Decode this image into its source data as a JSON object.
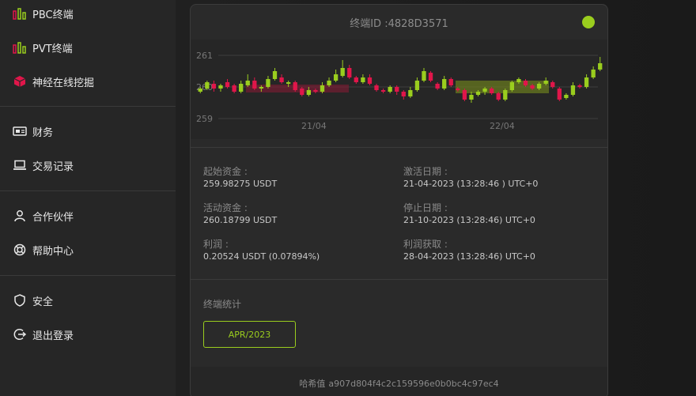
{
  "sidebar": {
    "items": [
      {
        "label": "PBC终端",
        "icon": "bar-chart-icon"
      },
      {
        "label": "PVT终端",
        "icon": "bar-chart-icon"
      },
      {
        "label": "神经在线挖掘",
        "icon": "cube-icon"
      },
      {
        "label": "财务",
        "icon": "wallet-icon"
      },
      {
        "label": "交易记录",
        "icon": "laptop-icon"
      },
      {
        "label": "合作伙伴",
        "icon": "user-icon"
      },
      {
        "label": "帮助中心",
        "icon": "lifebuoy-icon"
      },
      {
        "label": "安全",
        "icon": "shield-icon"
      },
      {
        "label": "退出登录",
        "icon": "logout-icon"
      }
    ]
  },
  "terminal": {
    "title": "终端ID :4828D3571",
    "status_color": "#9acd1e"
  },
  "chart_data": {
    "type": "candlestick",
    "y_ticks": [
      "261",
      "260",
      "259"
    ],
    "x_ticks": [
      "21/04",
      "22/04"
    ],
    "ylim": [
      258.8,
      261.3
    ],
    "bull_color": "#9acd1e",
    "bear_color": "#e0164a",
    "candles": [
      {
        "o": 259.85,
        "c": 259.95,
        "h": 260.0,
        "l": 259.8
      },
      {
        "o": 259.95,
        "c": 260.15,
        "h": 260.2,
        "l": 259.9
      },
      {
        "o": 260.1,
        "c": 259.95,
        "h": 260.2,
        "l": 259.85
      },
      {
        "o": 259.95,
        "c": 260.05,
        "h": 260.1,
        "l": 259.85
      },
      {
        "o": 260.15,
        "c": 260.0,
        "h": 260.25,
        "l": 259.95
      },
      {
        "o": 260.05,
        "c": 259.85,
        "h": 260.1,
        "l": 259.8
      },
      {
        "o": 259.85,
        "c": 260.1,
        "h": 260.2,
        "l": 259.8
      },
      {
        "o": 260.05,
        "c": 260.2,
        "h": 260.4,
        "l": 260.0
      },
      {
        "o": 260.2,
        "c": 259.95,
        "h": 260.3,
        "l": 259.9
      },
      {
        "o": 259.95,
        "c": 260.0,
        "h": 260.05,
        "l": 259.85
      },
      {
        "o": 260.0,
        "c": 260.25,
        "h": 260.35,
        "l": 259.95
      },
      {
        "o": 260.25,
        "c": 260.5,
        "h": 260.6,
        "l": 260.2
      },
      {
        "o": 260.3,
        "c": 260.15,
        "h": 260.4,
        "l": 260.1
      },
      {
        "o": 260.1,
        "c": 260.15,
        "h": 260.2,
        "l": 260.0
      },
      {
        "o": 260.15,
        "c": 259.9,
        "h": 260.2,
        "l": 259.85
      },
      {
        "o": 259.95,
        "c": 259.75,
        "h": 260.0,
        "l": 259.7
      },
      {
        "o": 259.75,
        "c": 259.9,
        "h": 260.0,
        "l": 259.7
      },
      {
        "o": 259.9,
        "c": 259.85,
        "h": 259.95,
        "l": 259.8
      },
      {
        "o": 259.85,
        "c": 260.05,
        "h": 260.15,
        "l": 259.8
      },
      {
        "o": 260.05,
        "c": 260.2,
        "h": 260.3,
        "l": 260.0
      },
      {
        "o": 260.2,
        "c": 260.4,
        "h": 260.55,
        "l": 260.15
      },
      {
        "o": 260.35,
        "c": 260.6,
        "h": 260.85,
        "l": 260.3
      },
      {
        "o": 260.6,
        "c": 260.3,
        "h": 260.7,
        "l": 260.25
      },
      {
        "o": 260.3,
        "c": 260.15,
        "h": 260.35,
        "l": 260.1
      },
      {
        "o": 260.15,
        "c": 260.3,
        "h": 260.4,
        "l": 260.1
      },
      {
        "o": 260.3,
        "c": 260.1,
        "h": 260.4,
        "l": 260.05
      },
      {
        "o": 260.05,
        "c": 259.9,
        "h": 260.1,
        "l": 259.85
      },
      {
        "o": 259.9,
        "c": 259.85,
        "h": 259.95,
        "l": 259.8
      },
      {
        "o": 259.85,
        "c": 260.0,
        "h": 260.05,
        "l": 259.8
      },
      {
        "o": 260.0,
        "c": 259.85,
        "h": 260.05,
        "l": 259.75
      },
      {
        "o": 259.85,
        "c": 259.7,
        "h": 259.9,
        "l": 259.6
      },
      {
        "o": 259.7,
        "c": 259.9,
        "h": 260.0,
        "l": 259.65
      },
      {
        "o": 259.9,
        "c": 260.2,
        "h": 260.3,
        "l": 259.85
      },
      {
        "o": 260.2,
        "c": 260.5,
        "h": 260.6,
        "l": 260.15
      },
      {
        "o": 260.45,
        "c": 260.2,
        "h": 260.5,
        "l": 260.15
      },
      {
        "o": 260.1,
        "c": 259.95,
        "h": 260.15,
        "l": 259.9
      },
      {
        "o": 259.95,
        "c": 260.25,
        "h": 260.35,
        "l": 259.9
      },
      {
        "o": 260.25,
        "c": 260.05,
        "h": 260.3,
        "l": 260.0
      },
      {
        "o": 259.95,
        "c": 259.9,
        "h": 260.0,
        "l": 259.85
      },
      {
        "o": 259.9,
        "c": 259.6,
        "h": 259.95,
        "l": 259.55
      },
      {
        "o": 259.6,
        "c": 259.75,
        "h": 259.85,
        "l": 259.5
      },
      {
        "o": 259.75,
        "c": 259.85,
        "h": 259.9,
        "l": 259.7
      },
      {
        "o": 259.85,
        "c": 259.95,
        "h": 260.0,
        "l": 259.75
      },
      {
        "o": 259.95,
        "c": 259.8,
        "h": 260.0,
        "l": 259.75
      },
      {
        "o": 259.8,
        "c": 259.6,
        "h": 259.85,
        "l": 259.55
      },
      {
        "o": 259.6,
        "c": 259.9,
        "h": 259.95,
        "l": 259.55
      },
      {
        "o": 259.9,
        "c": 260.15,
        "h": 260.2,
        "l": 259.85
      },
      {
        "o": 260.15,
        "c": 260.25,
        "h": 260.3,
        "l": 260.1
      },
      {
        "o": 260.2,
        "c": 260.05,
        "h": 260.25,
        "l": 260.0
      },
      {
        "o": 260.05,
        "c": 259.95,
        "h": 260.1,
        "l": 259.9
      },
      {
        "o": 259.95,
        "c": 260.1,
        "h": 260.15,
        "l": 259.9
      },
      {
        "o": 260.1,
        "c": 260.2,
        "h": 260.3,
        "l": 260.05
      },
      {
        "o": 260.15,
        "c": 260.0,
        "h": 260.2,
        "l": 259.95
      },
      {
        "o": 259.95,
        "c": 259.6,
        "h": 260.0,
        "l": 259.55
      },
      {
        "o": 259.65,
        "c": 259.75,
        "h": 259.8,
        "l": 259.6
      },
      {
        "o": 259.75,
        "c": 260.05,
        "h": 260.15,
        "l": 259.7
      },
      {
        "o": 260.05,
        "c": 260.0,
        "h": 260.1,
        "l": 259.95
      },
      {
        "o": 260.0,
        "c": 260.3,
        "h": 260.4,
        "l": 259.95
      },
      {
        "o": 260.3,
        "c": 260.55,
        "h": 260.65,
        "l": 260.25
      },
      {
        "o": 260.55,
        "c": 260.75,
        "h": 260.95,
        "l": 260.5
      }
    ]
  },
  "info": {
    "start_funds_label": "起始资金 :",
    "start_funds_value": "259.98275 USDT",
    "activation_date_label": "激活日期 :",
    "activation_date_value": "21-04-2023 (13:28:46 ) UTC+0",
    "active_funds_label": "活动资金 :",
    "active_funds_value": "260.18799 USDT",
    "stop_date_label": "停止日期 :",
    "stop_date_value": "21-10-2023 (13:28:46) UTC+0",
    "profit_label": "利润 :",
    "profit_value": "0.20524 USDT (0.07894%)",
    "profit_taking_label": "利润获取 :",
    "profit_taking_value": "28-04-2023 (13:28:46) UTC+0"
  },
  "stats": {
    "title": "终端统计",
    "month_button": "APR/2023"
  },
  "footer": {
    "hash_label": "哈希值",
    "hash_value": "a907d804f4c2c159596e0b0bc4c97ec4"
  }
}
